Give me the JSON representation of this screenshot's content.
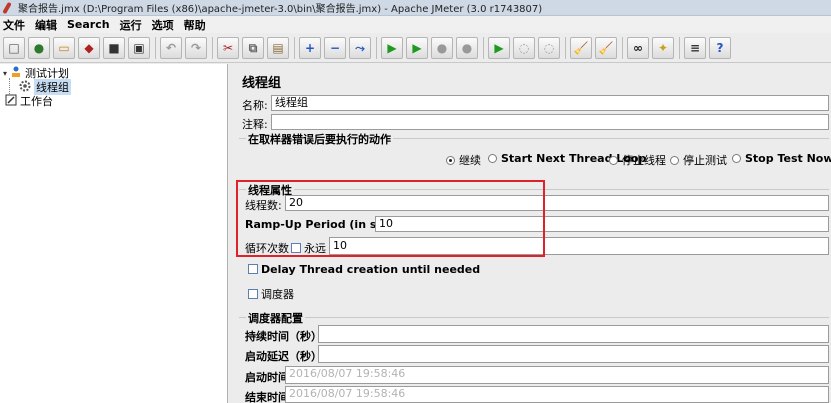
{
  "window": {
    "title": "聚合报告.jmx (D:\\Program Files (x86)\\apache-jmeter-3.0\\bin\\聚合报告.jmx) - Apache JMeter (3.0 r1743807)"
  },
  "menu": [
    "文件",
    "编辑",
    "Search",
    "运行",
    "选项",
    "帮助"
  ],
  "toolbar": {
    "buttons": [
      "new-icon",
      "templates-icon",
      "open-icon",
      "close-icon",
      "save-icon",
      "save-screenshot-icon",
      "undo-icon",
      "redo-icon",
      "cut-icon",
      "copy-icon",
      "paste-icon",
      "expand-icon",
      "collapse-icon",
      "toggle-icon",
      "start-icon",
      "start-no-pauses-icon",
      "stop-icon",
      "shutdown-icon",
      "remote-start-icon",
      "remote-stop-icon",
      "remote-shutdown-icon",
      "clear-icon",
      "clear-all-icon",
      "search-icon",
      "reset-search-icon",
      "function-helper-icon",
      "help-icon"
    ],
    "glyphs": [
      "□",
      "●",
      "▭",
      "◆",
      "■",
      "▣",
      "↶",
      "↷",
      "✂",
      "⧉",
      "▤",
      "+",
      "−",
      "⤳",
      "▶",
      "▶",
      "●",
      "●",
      "▶",
      "◌",
      "◌",
      "🧹",
      "🧹",
      "∞",
      "✦",
      "≡",
      "?"
    ]
  },
  "tree": {
    "root": "测试计划",
    "thread_group": "线程组",
    "workbench": "工作台"
  },
  "panel": {
    "title": "线程组",
    "name_label": "名称:",
    "name_value": "线程组",
    "comment_label": "注释:",
    "comment_value": "",
    "error_action": {
      "group_title": "在取样器错误后要执行的动作",
      "options": [
        "继续",
        "Start Next Thread Loop",
        "停止线程",
        "停止测试",
        "Stop Test Now"
      ],
      "selected": "继续"
    },
    "thread_props": {
      "group_title": "线程属性",
      "threads_label": "线程数:",
      "threads_value": "20",
      "rampup_label": "Ramp-Up Period (in seconds):",
      "rampup_value": "10",
      "loop_label": "循环次数",
      "forever_label": "永远",
      "forever_checked": false,
      "loop_value": "10"
    },
    "delay_label": "Delay Thread creation until needed",
    "delay_checked": false,
    "scheduler_label": "调度器",
    "scheduler_checked": false,
    "scheduler_config": {
      "group_title": "调度器配置",
      "duration_label": "持续时间（秒）",
      "duration_value": "",
      "startup_delay_label": "启动延迟（秒）",
      "startup_delay_value": "",
      "start_time_label": "启动时间",
      "start_time_value": "2016/08/07 19:58:46",
      "end_time_label": "结束时间",
      "end_time_value": "2016/08/07 19:58:46"
    }
  },
  "colors": {
    "highlight": "#e0212a",
    "selected_tree": "#c7ddf4"
  }
}
